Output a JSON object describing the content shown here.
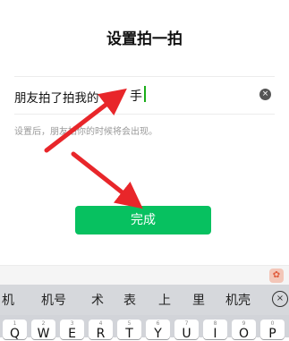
{
  "page": {
    "title": "设置拍一拍"
  },
  "field": {
    "prefix": "朋友拍了拍我的",
    "value": "手",
    "clear_icon": "×"
  },
  "hint": "设置后，朋友拍你的时候将会出现。",
  "done_label": "完成",
  "toolbar": {
    "icon": "✿"
  },
  "candidates": [
    "机",
    "机号",
    "术",
    "表",
    "上",
    "里",
    "机壳"
  ],
  "candidate_close": "×",
  "keyboard": {
    "keys": [
      {
        "hint": "1",
        "letter": "Q"
      },
      {
        "hint": "2",
        "letter": "W"
      },
      {
        "hint": "3",
        "letter": "E"
      },
      {
        "hint": "4",
        "letter": "R"
      },
      {
        "hint": "5",
        "letter": "T"
      },
      {
        "hint": "6",
        "letter": "Y"
      },
      {
        "hint": "7",
        "letter": "U"
      },
      {
        "hint": "8",
        "letter": "I"
      },
      {
        "hint": "9",
        "letter": "O"
      },
      {
        "hint": "0",
        "letter": "P"
      }
    ]
  },
  "colors": {
    "accent": "#07c160",
    "caret": "#1aad19",
    "annotation_arrow": "#e8262a"
  }
}
